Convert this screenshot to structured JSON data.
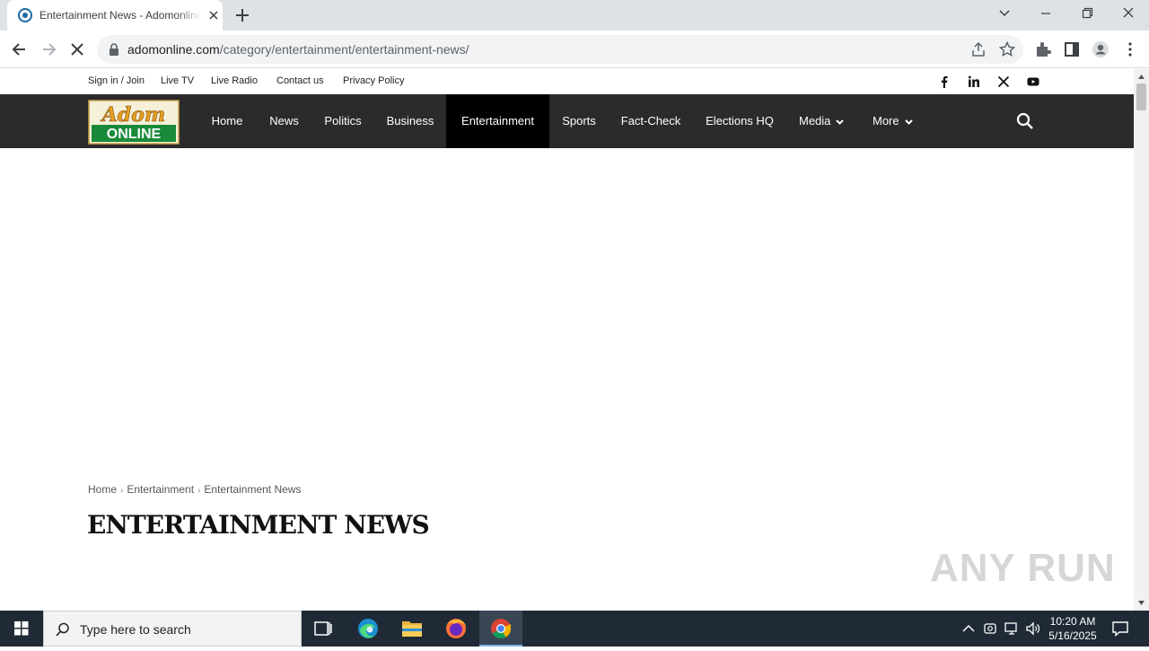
{
  "browser": {
    "tab_title": "Entertainment News - Adomonline.com",
    "url_domain": "adomonline.com",
    "url_path": "/category/entertainment/entertainment-news/"
  },
  "topbar": {
    "links": [
      "Sign in / Join",
      "Live TV",
      "Live Radio",
      "Contact us",
      "Privacy Policy"
    ],
    "social_icons": [
      "facebook-icon",
      "linkedin-icon",
      "x-icon",
      "youtube-icon"
    ]
  },
  "logo": {
    "line1": "Adom",
    "line2": "ONLINE"
  },
  "nav": {
    "items": [
      "Home",
      "News",
      "Politics",
      "Business",
      "Entertainment",
      "Sports",
      "Fact-Check",
      "Elections HQ",
      "Media",
      "More"
    ],
    "active": "Entertainment"
  },
  "breadcrumb": [
    "Home",
    "Entertainment",
    "Entertainment News"
  ],
  "page_title": "ENTERTAINMENT NEWS",
  "watermark": "ANY RUN",
  "taskbar": {
    "search_placeholder": "Type here to search",
    "time": "10:20 AM",
    "date": "5/16/2025"
  },
  "colors": {
    "nav_bg": "#2b2b2b",
    "nav_active": "#000000",
    "logo_green": "#1a8a3a",
    "logo_orange": "#e8a020"
  }
}
